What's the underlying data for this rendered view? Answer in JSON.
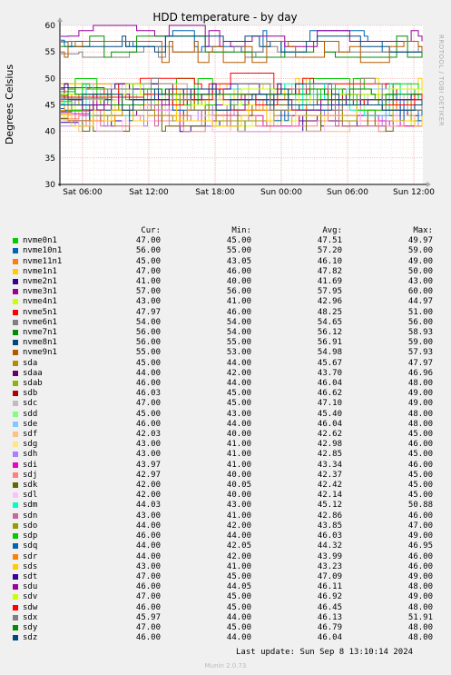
{
  "chart_data": {
    "type": "line",
    "title": "HDD temperature - by day",
    "ylabel": "Degrees Celsius",
    "ylim": [
      30,
      60
    ],
    "yticks": [
      30,
      35,
      40,
      45,
      50,
      55,
      60
    ],
    "xticks": [
      "Sat 06:00",
      "Sat 12:00",
      "Sat 18:00",
      "Sun 00:00",
      "Sun 06:00",
      "Sun 12:00"
    ],
    "grid": true,
    "legend_position": "bottom",
    "legend_headers": [
      "Cur:",
      "Min:",
      "Avg:",
      "Max:"
    ],
    "series": [
      {
        "name": "nvme0n1",
        "color": "#00cc00",
        "cur": "47.00",
        "min": "45.00",
        "avg": "47.51",
        "max": "49.97"
      },
      {
        "name": "nvme10n1",
        "color": "#0066b3",
        "cur": "56.00",
        "min": "55.00",
        "avg": "57.20",
        "max": "59.00"
      },
      {
        "name": "nvme11n1",
        "color": "#ff8000",
        "cur": "45.00",
        "min": "43.05",
        "avg": "46.10",
        "max": "49.00"
      },
      {
        "name": "nvme1n1",
        "color": "#ffcc00",
        "cur": "47.00",
        "min": "46.00",
        "avg": "47.82",
        "max": "50.00"
      },
      {
        "name": "nvme2n1",
        "color": "#330099",
        "cur": "41.00",
        "min": "40.00",
        "avg": "41.69",
        "max": "43.00"
      },
      {
        "name": "nvme3n1",
        "color": "#990099",
        "cur": "57.00",
        "min": "56.00",
        "avg": "57.95",
        "max": "60.00"
      },
      {
        "name": "nvme4n1",
        "color": "#ccff00",
        "cur": "43.00",
        "min": "41.00",
        "avg": "42.96",
        "max": "44.97"
      },
      {
        "name": "nvme5n1",
        "color": "#ff0000",
        "cur": "47.97",
        "min": "46.00",
        "avg": "48.25",
        "max": "51.00"
      },
      {
        "name": "nvme6n1",
        "color": "#808080",
        "cur": "54.00",
        "min": "54.00",
        "avg": "54.65",
        "max": "56.00"
      },
      {
        "name": "nvme7n1",
        "color": "#008f00",
        "cur": "56.00",
        "min": "54.00",
        "avg": "56.12",
        "max": "58.93"
      },
      {
        "name": "nvme8n1",
        "color": "#00487d",
        "cur": "56.00",
        "min": "55.00",
        "avg": "56.91",
        "max": "59.00"
      },
      {
        "name": "nvme9n1",
        "color": "#b35a00",
        "cur": "55.00",
        "min": "53.00",
        "avg": "54.98",
        "max": "57.93"
      },
      {
        "name": "sda",
        "color": "#b38f00",
        "cur": "45.00",
        "min": "44.00",
        "avg": "45.67",
        "max": "47.97"
      },
      {
        "name": "sdaa",
        "color": "#6b006b",
        "cur": "44.00",
        "min": "42.00",
        "avg": "43.70",
        "max": "46.96"
      },
      {
        "name": "sdab",
        "color": "#8fb300",
        "cur": "46.00",
        "min": "44.00",
        "avg": "46.04",
        "max": "48.00"
      },
      {
        "name": "sdb",
        "color": "#b30000",
        "cur": "46.03",
        "min": "45.00",
        "avg": "46.62",
        "max": "49.00"
      },
      {
        "name": "sdc",
        "color": "#bebebe",
        "cur": "47.00",
        "min": "45.00",
        "avg": "47.10",
        "max": "49.00"
      },
      {
        "name": "sdd",
        "color": "#80ff80",
        "cur": "45.00",
        "min": "43.00",
        "avg": "45.40",
        "max": "48.00"
      },
      {
        "name": "sde",
        "color": "#80c9ff",
        "cur": "46.00",
        "min": "44.00",
        "avg": "46.04",
        "max": "48.00"
      },
      {
        "name": "sdf",
        "color": "#ffc080",
        "cur": "42.03",
        "min": "40.00",
        "avg": "42.62",
        "max": "45.00"
      },
      {
        "name": "sdg",
        "color": "#ffe680",
        "cur": "43.00",
        "min": "41.00",
        "avg": "42.98",
        "max": "46.00"
      },
      {
        "name": "sdh",
        "color": "#aa80ff",
        "cur": "43.00",
        "min": "41.00",
        "avg": "42.85",
        "max": "45.00"
      },
      {
        "name": "sdi",
        "color": "#ee00cc",
        "cur": "43.97",
        "min": "41.00",
        "avg": "43.34",
        "max": "46.00"
      },
      {
        "name": "sdj",
        "color": "#ff8080",
        "cur": "42.97",
        "min": "40.00",
        "avg": "42.37",
        "max": "45.00"
      },
      {
        "name": "sdk",
        "color": "#666600",
        "cur": "42.00",
        "min": "40.05",
        "avg": "42.42",
        "max": "45.00"
      },
      {
        "name": "sdl",
        "color": "#ffbfff",
        "cur": "42.00",
        "min": "40.00",
        "avg": "42.14",
        "max": "45.00"
      },
      {
        "name": "sdm",
        "color": "#00ffcc",
        "cur": "44.03",
        "min": "43.00",
        "avg": "45.12",
        "max": "50.88"
      },
      {
        "name": "sdn",
        "color": "#cc6699",
        "cur": "43.00",
        "min": "41.00",
        "avg": "42.86",
        "max": "46.00"
      },
      {
        "name": "sdo",
        "color": "#999900",
        "cur": "44.00",
        "min": "42.00",
        "avg": "43.85",
        "max": "47.00"
      },
      {
        "name": "sdp",
        "color": "#00cc00",
        "cur": "46.00",
        "min": "44.00",
        "avg": "46.03",
        "max": "49.00"
      },
      {
        "name": "sdq",
        "color": "#0066b3",
        "cur": "44.00",
        "min": "42.05",
        "avg": "44.32",
        "max": "46.95"
      },
      {
        "name": "sdr",
        "color": "#ff8000",
        "cur": "44.00",
        "min": "42.00",
        "avg": "43.99",
        "max": "46.00"
      },
      {
        "name": "sds",
        "color": "#ffcc00",
        "cur": "43.00",
        "min": "41.00",
        "avg": "43.23",
        "max": "46.00"
      },
      {
        "name": "sdt",
        "color": "#330099",
        "cur": "47.00",
        "min": "45.00",
        "avg": "47.09",
        "max": "49.00"
      },
      {
        "name": "sdu",
        "color": "#990099",
        "cur": "46.00",
        "min": "44.05",
        "avg": "46.11",
        "max": "48.00"
      },
      {
        "name": "sdv",
        "color": "#ccff00",
        "cur": "47.00",
        "min": "45.00",
        "avg": "46.92",
        "max": "49.00"
      },
      {
        "name": "sdw",
        "color": "#ff0000",
        "cur": "46.00",
        "min": "45.00",
        "avg": "46.45",
        "max": "48.00"
      },
      {
        "name": "sdx",
        "color": "#808080",
        "cur": "45.97",
        "min": "44.00",
        "avg": "46.13",
        "max": "51.91"
      },
      {
        "name": "sdy",
        "color": "#008f00",
        "cur": "47.00",
        "min": "45.00",
        "avg": "46.79",
        "max": "48.00"
      },
      {
        "name": "sdz",
        "color": "#00487d",
        "cur": "46.00",
        "min": "44.00",
        "avg": "46.04",
        "max": "48.00"
      }
    ]
  },
  "watermark": "RRDTOOL / TOBI OETIKER",
  "footer": {
    "last_update": "Last update: Sun Sep  8 13:10:14 2024",
    "munin_version": "Munin 2.0.73"
  }
}
